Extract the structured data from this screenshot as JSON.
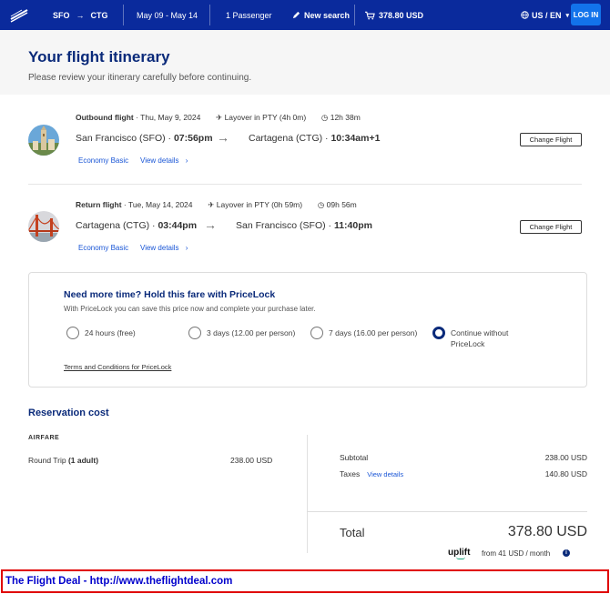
{
  "header": {
    "origin": "SFO",
    "destination": "CTG",
    "dates": "May 09 - May 14",
    "passengers": "1 Passenger",
    "new_search": "New search",
    "cart_total": "378.80 USD",
    "locale": "US / EN",
    "login": "LOG IN"
  },
  "page": {
    "title": "Your flight itinerary",
    "subtitle": "Please review your itinerary carefully before continuing."
  },
  "flights": [
    {
      "label": "Outbound flight",
      "date": "Thu, May 9, 2024",
      "layover": "Layover in PTY (4h 0m)",
      "duration": "12h 38m",
      "from_city": "San Francisco (SFO)",
      "from_time": "07:56pm",
      "to_city": "Cartagena (CTG)",
      "to_time": "10:34am+1",
      "fare": "Economy Basic",
      "details": "View details",
      "change": "Change Flight"
    },
    {
      "label": "Return flight",
      "date": "Tue, May 14, 2024",
      "layover": "Layover in PTY (0h 59m)",
      "duration": "09h 56m",
      "from_city": "Cartagena (CTG)",
      "from_time": "03:44pm",
      "to_city": "San Francisco (SFO)",
      "to_time": "11:40pm",
      "fare": "Economy Basic",
      "details": "View details",
      "change": "Change Flight"
    }
  ],
  "pricelock": {
    "title": "Need more time? Hold this fare with PriceLock",
    "subtitle": "With PriceLock you can save this price now and complete your purchase later.",
    "options": [
      {
        "label": "24 hours (free)",
        "selected": false
      },
      {
        "label": "3 days (12.00 per person)",
        "selected": false
      },
      {
        "label": "7 days (16.00 per person)",
        "selected": false
      },
      {
        "label": "Continue without PriceLock",
        "selected": true
      }
    ],
    "terms": "Terms and Conditions for PriceLock"
  },
  "reservation": {
    "title": "Reservation cost",
    "airfare_label": "AIRFARE",
    "round_trip": "Round Trip",
    "adults": "(1 adult)",
    "round_trip_value": "238.00 USD",
    "subtotal_label": "Subtotal",
    "subtotal_value": "238.00 USD",
    "taxes_label": "Taxes",
    "taxes_link": "View details",
    "taxes_value": "140.80 USD",
    "total_label": "Total",
    "total_value": "378.80 USD",
    "uplift_brand": "uplift",
    "uplift_text": "from 41 USD  / month"
  },
  "footer": {
    "text": "The Flight Deal - http://www.theflightdeal.com"
  },
  "colors": {
    "header_bg": "#0a2a9c",
    "title_blue": "#0a2a7a",
    "link_blue": "#1a56d6",
    "login_blue": "#1273eb",
    "footer_border": "#e00000",
    "footer_text": "#0000cc"
  }
}
